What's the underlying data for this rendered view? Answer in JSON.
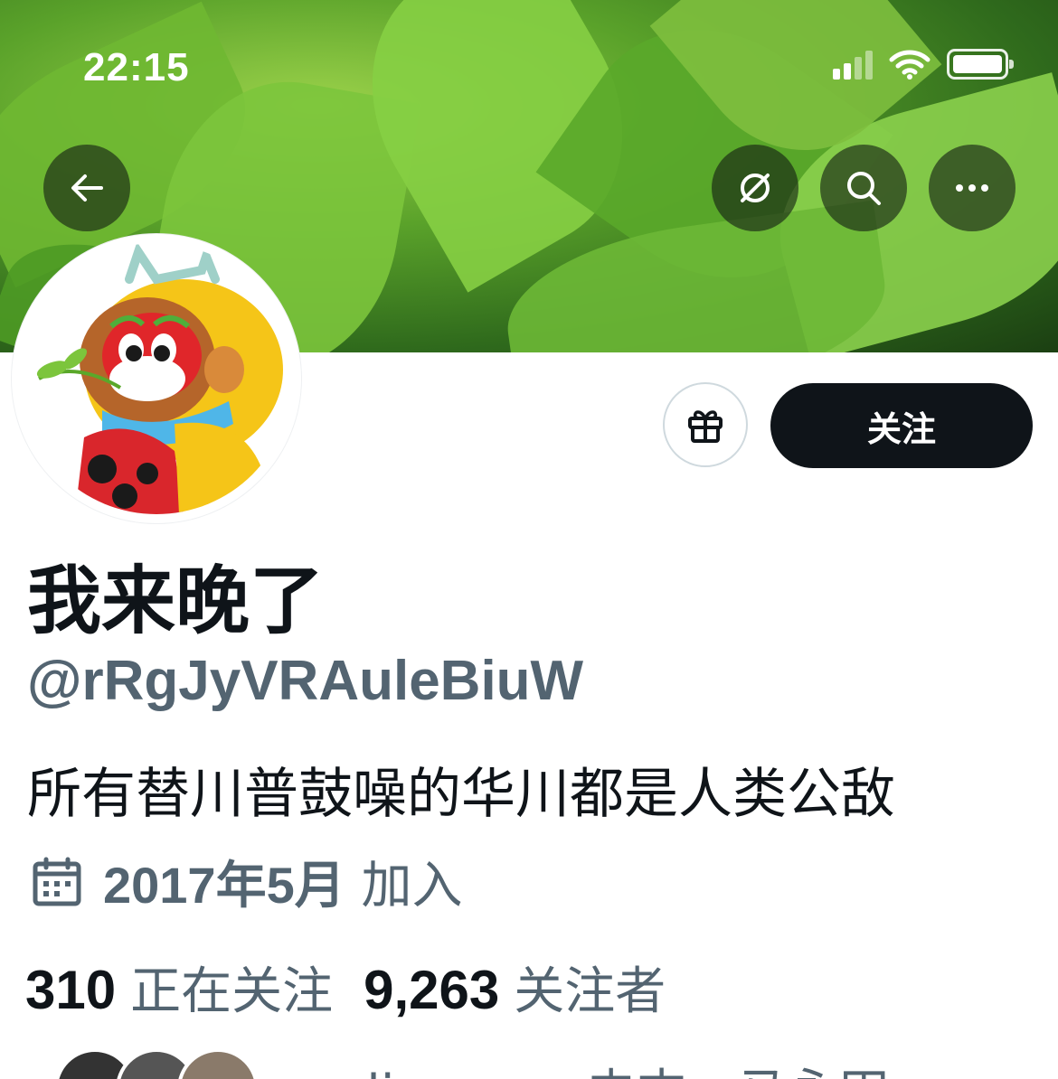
{
  "status_bar": {
    "time": "22:15"
  },
  "header": {
    "back_icon": "arrow-left-icon",
    "grok_icon": "grok-icon",
    "search_icon": "search-icon",
    "more_icon": "more-horizontal-icon"
  },
  "profile": {
    "display_name": "我来晚了",
    "handle": "@rRgJyVRAuleBiuW",
    "bio": "所有替川普鼓噪的华川都是人类公敌",
    "joined_date": "2017年5月",
    "joined_suffix": "加入",
    "following_count": "310",
    "following_label": "正在关注",
    "followers_count": "9,263",
    "followers_label": "关注者"
  },
  "actions": {
    "follow_label": "关注",
    "gift_icon": "gift-icon"
  },
  "followed_by": {
    "names": "wulisoren、史杰、马永田"
  },
  "colors": {
    "primary_text": "#0f1419",
    "secondary_text": "#536471",
    "button_dark": "#0f1419",
    "border": "#cfd9de"
  }
}
